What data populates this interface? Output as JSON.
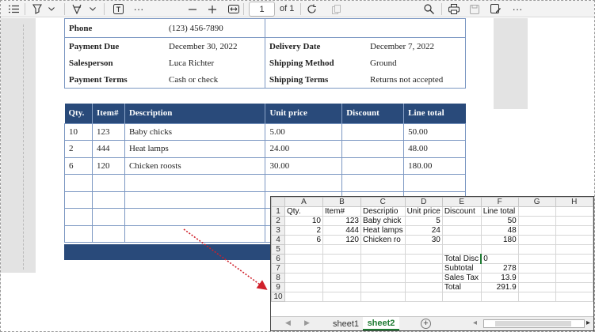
{
  "toolbar": {
    "page_number": "1",
    "page_of": "of 1"
  },
  "info": {
    "rows": [
      {
        "label1": "Phone",
        "value1": "(123) 456-7890",
        "label2": "",
        "value2": ""
      },
      {
        "label1": "Payment Due",
        "value1": "December 30, 2022",
        "label2": "Delivery Date",
        "value2": "December 7, 2022"
      },
      {
        "label1": "Salesperson",
        "value1": "Luca Richter",
        "label2": "Shipping Method",
        "value2": "Ground"
      },
      {
        "label1": "Payment Terms",
        "value1": "Cash or check",
        "label2": "Shipping Terms",
        "value2": "Returns not accepted"
      }
    ]
  },
  "items": {
    "headers": [
      "Qty.",
      "Item#",
      "Description",
      "Unit price",
      "Discount",
      "Line total"
    ],
    "rows": [
      [
        "10",
        "123",
        "Baby chicks",
        "5.00",
        "",
        "50.00"
      ],
      [
        "2",
        "444",
        "Heat lamps",
        "24.00",
        "",
        "48.00"
      ],
      [
        "6",
        "120",
        "Chicken roosts",
        "30.00",
        "",
        "180.00"
      ],
      [
        "",
        "",
        "",
        "",
        "",
        ""
      ],
      [
        "",
        "",
        "",
        "",
        "",
        ""
      ],
      [
        "",
        "",
        "",
        "",
        "",
        ""
      ],
      [
        "",
        "",
        "",
        "",
        "",
        ""
      ]
    ]
  },
  "sheet": {
    "columns": [
      "A",
      "B",
      "C",
      "D",
      "E",
      "F",
      "G",
      "H"
    ],
    "rows": [
      {
        "n": "1",
        "cells": [
          "Qty.",
          "Item#",
          "Descriptio",
          "Unit price",
          "Discount",
          "Line total",
          "",
          ""
        ]
      },
      {
        "n": "2",
        "cells": [
          "10",
          "123",
          "Baby chick",
          "5",
          "",
          "50",
          "",
          ""
        ]
      },
      {
        "n": "3",
        "cells": [
          "2",
          "444",
          "Heat lamps",
          "24",
          "",
          "48",
          "",
          ""
        ]
      },
      {
        "n": "4",
        "cells": [
          "6",
          "120",
          "Chicken ro",
          "30",
          "",
          "180",
          "",
          ""
        ]
      },
      {
        "n": "5",
        "cells": [
          "",
          "",
          "",
          "",
          "",
          "",
          "",
          ""
        ]
      },
      {
        "n": "6",
        "cells": [
          "",
          "",
          "",
          "",
          "Total Disc",
          "0",
          "",
          ""
        ]
      },
      {
        "n": "7",
        "cells": [
          "",
          "",
          "",
          "",
          "Subtotal",
          "278",
          "",
          ""
        ]
      },
      {
        "n": "8",
        "cells": [
          "",
          "",
          "",
          "",
          "Sales Tax",
          "13.9",
          "",
          ""
        ]
      },
      {
        "n": "9",
        "cells": [
          "",
          "",
          "",
          "",
          "Total",
          "291.9",
          "",
          ""
        ]
      },
      {
        "n": "10",
        "cells": [
          "",
          "",
          "",
          "",
          "",
          "",
          "",
          ""
        ]
      }
    ],
    "tabs": [
      "sheet1",
      "sheet2"
    ],
    "active_tab": "sheet2"
  },
  "colors": {
    "header_blue": "#294a7a",
    "border_blue": "#7b97c2",
    "active_tab_green": "#1e7a32",
    "arrow_red": "#d0202a"
  }
}
